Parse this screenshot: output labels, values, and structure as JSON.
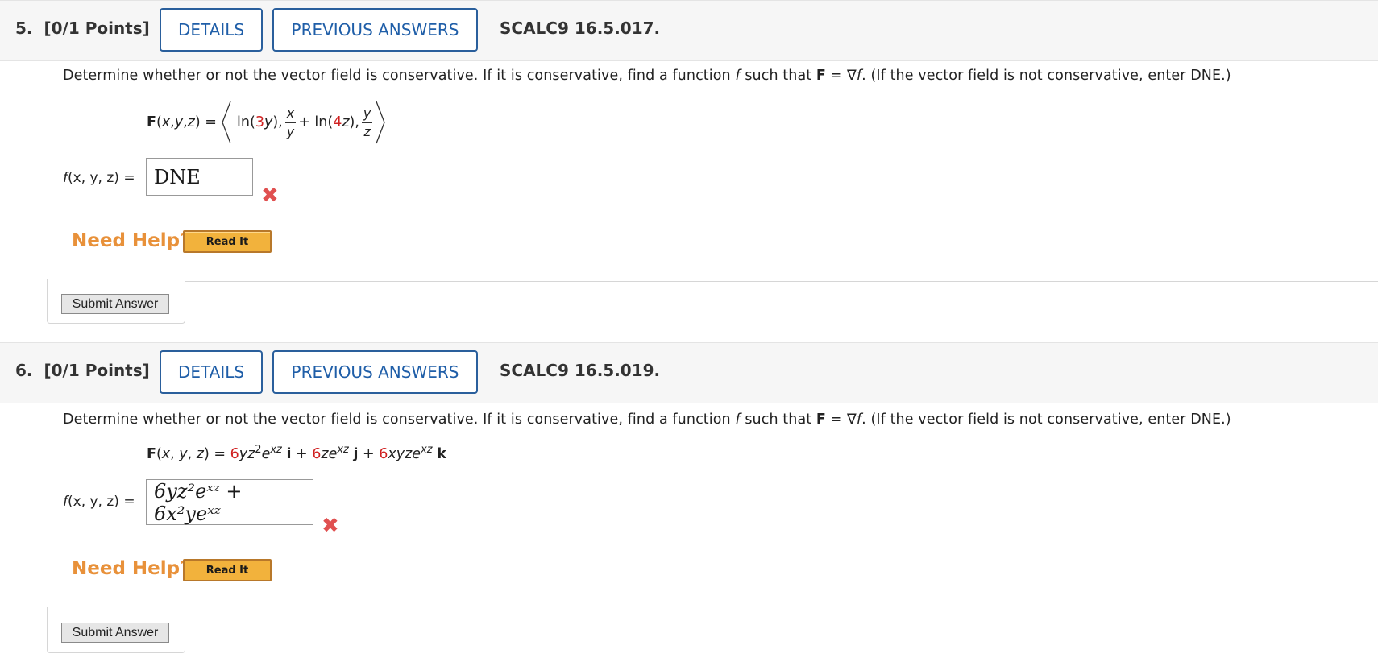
{
  "questions": [
    {
      "number": "5.",
      "points": "[0/1 Points]",
      "details_label": "DETAILS",
      "prev_label": "PREVIOUS ANSWERS",
      "code": "SCALC9 16.5.017.",
      "prompt_pre": "Determine whether or not the vector field is conservative. If it is conservative, find a function ",
      "prompt_f": "f",
      "prompt_mid": " such that ",
      "prompt_F": "F",
      "prompt_eq": " = ∇",
      "prompt_f2": "f",
      "prompt_post": ". (If the vector field is not conservative, enter DNE.)",
      "field_lhs": "(x, y, z) = ",
      "answer_label": "(x, y, z) = ",
      "answer_value": "DNE",
      "status": "incorrect",
      "help_label": "Need Help?",
      "read_label": "Read It",
      "submit_label": "Submit Answer"
    },
    {
      "number": "6.",
      "points": "[0/1 Points]",
      "details_label": "DETAILS",
      "prev_label": "PREVIOUS ANSWERS",
      "code": "SCALC9 16.5.019.",
      "prompt_pre": "Determine whether or not the vector field is conservative. If it is conservative, find a function ",
      "prompt_f": "f",
      "prompt_mid": " such that ",
      "prompt_F": "F",
      "prompt_eq": " = ∇",
      "prompt_f2": "f",
      "prompt_post": ". (If the vector field is not conservative, enter DNE.)",
      "answer_label": "(x, y, z) = ",
      "answer_value": "6yz²eˣᶻ + 6x²yeˣᶻ",
      "status": "incorrect",
      "help_label": "Need Help?",
      "read_label": "Read It",
      "submit_label": "Submit Answer"
    }
  ],
  "colors": {
    "accent_blue": "#1f5ea8",
    "help_orange": "#e8913a",
    "error_red": "#e05050",
    "coefficient_red": "#d02020",
    "read_button": "#f2b23c"
  },
  "icons": [
    "incorrect-x-icon"
  ]
}
